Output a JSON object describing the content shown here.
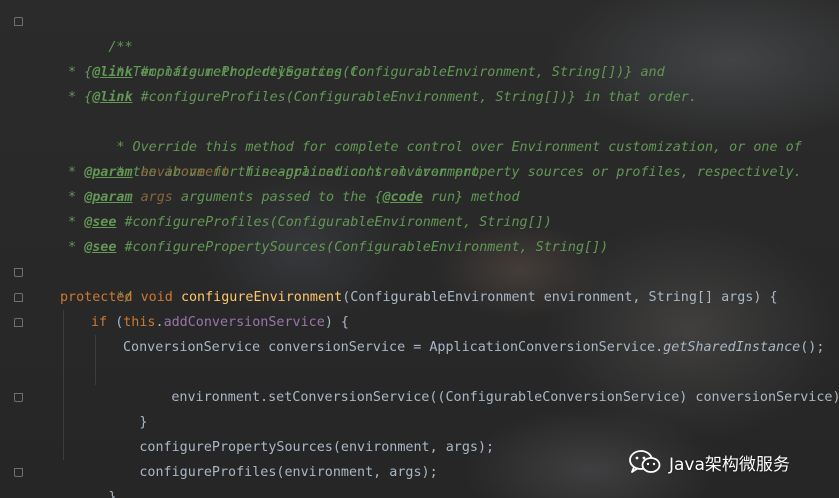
{
  "editor": {
    "theme_colors": {
      "background": "#2b2b2b",
      "doc_comment": "#629755",
      "doc_param_name": "#8a653b",
      "keyword": "#cc7832",
      "method_decl": "#ffc66d",
      "field": "#9876aa",
      "default_text": "#a9b7c6"
    },
    "lines": {
      "l1": {
        "text": "/**"
      },
      "l2": {
        "text": " * Template method delegating to"
      },
      "l3": {
        "star": " * {",
        "tag": "@link",
        "rest": " #configurePropertySources(ConfigurableEnvironment, String[])} and"
      },
      "l4": {
        "star": " * {",
        "tag": "@link",
        "rest": " #configureProfiles(ConfigurableEnvironment, String[])} in that order."
      },
      "l5": {
        "text": " * Override this method for complete control over Environment customization, or one of"
      },
      "l6": {
        "text": " * the above for fine-grained control over property sources or profiles, respectively."
      },
      "l7": {
        "star": " * ",
        "tag": "@param",
        "name": " environment",
        "rest": " this application's environment"
      },
      "l8": {
        "star": " * ",
        "tag": "@param",
        "name": " args",
        "rest": " arguments passed to the {",
        "tag2": "@code",
        "rest2": " run} method"
      },
      "l9": {
        "star": " * ",
        "tag": "@see",
        "rest": " #configureProfiles(ConfigurableEnvironment, String[])"
      },
      "l10": {
        "star": " * ",
        "tag": "@see",
        "rest": " #configurePropertySources(ConfigurableEnvironment, String[])"
      },
      "l11": {
        "text": " */"
      },
      "l12": {
        "kw": "protected void ",
        "fn": "configureEnvironment",
        "rest": "(ConfigurableEnvironment environment, String[] args) {"
      },
      "l13": {
        "kw": "if ",
        "open": "(",
        "this": "this",
        "dot": ".",
        "field": "addConversionService",
        "rest": ") {"
      },
      "l14": {
        "pre": "ConversionService conversionService = ApplicationConversionService.",
        "static": "getSharedInstance",
        "rest": "();"
      },
      "l15": {
        "text": "environment.setConversionService((ConfigurableConversionService) conversionService);"
      },
      "l16": {
        "text": "}"
      },
      "l17": {
        "text": "configurePropertySources(environment, args);"
      },
      "l18": {
        "text": "configureProfiles(environment, args);"
      },
      "l19": {
        "text": "}"
      }
    }
  },
  "watermark": {
    "icon": "wechat-icon",
    "text": "Java架构微服务"
  }
}
